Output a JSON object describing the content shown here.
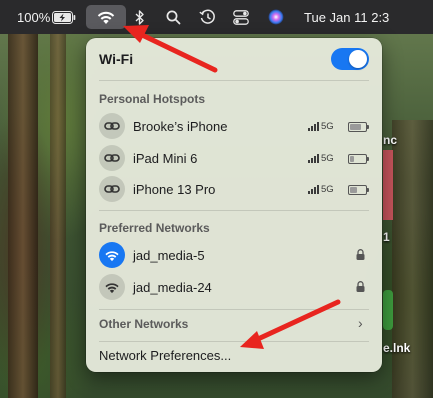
{
  "menubar": {
    "battery_percent": "100%",
    "date_time": "Tue Jan 11  2:3"
  },
  "wifi_panel": {
    "title": "Wi-Fi",
    "wifi_enabled": true,
    "personal_hotspots_title": "Personal Hotspots",
    "hotspots": [
      {
        "name": "Brooke’s iPhone",
        "network": "5G",
        "signal_bars": 4,
        "battery_level": 0.75
      },
      {
        "name": "iPad Mini 6",
        "network": "5G",
        "signal_bars": 4,
        "battery_level": 0.25
      },
      {
        "name": "iPhone 13 Pro",
        "network": "5G",
        "signal_bars": 4,
        "battery_level": 0.5
      }
    ],
    "preferred_networks_title": "Preferred Networks",
    "preferred_networks": [
      {
        "name": "jad_media-5",
        "connected": true,
        "secured": true
      },
      {
        "name": "jad_media-24",
        "connected": false,
        "secured": true
      }
    ],
    "other_networks_label": "Other Networks",
    "network_preferences_label": "Network Preferences..."
  },
  "background_text": {
    "right_top": "nc",
    "right_mid": "1",
    "right_bottom": "e.lnk"
  },
  "colors": {
    "accent_blue": "#1877f2",
    "annotation_arrow": "#e8251f"
  }
}
